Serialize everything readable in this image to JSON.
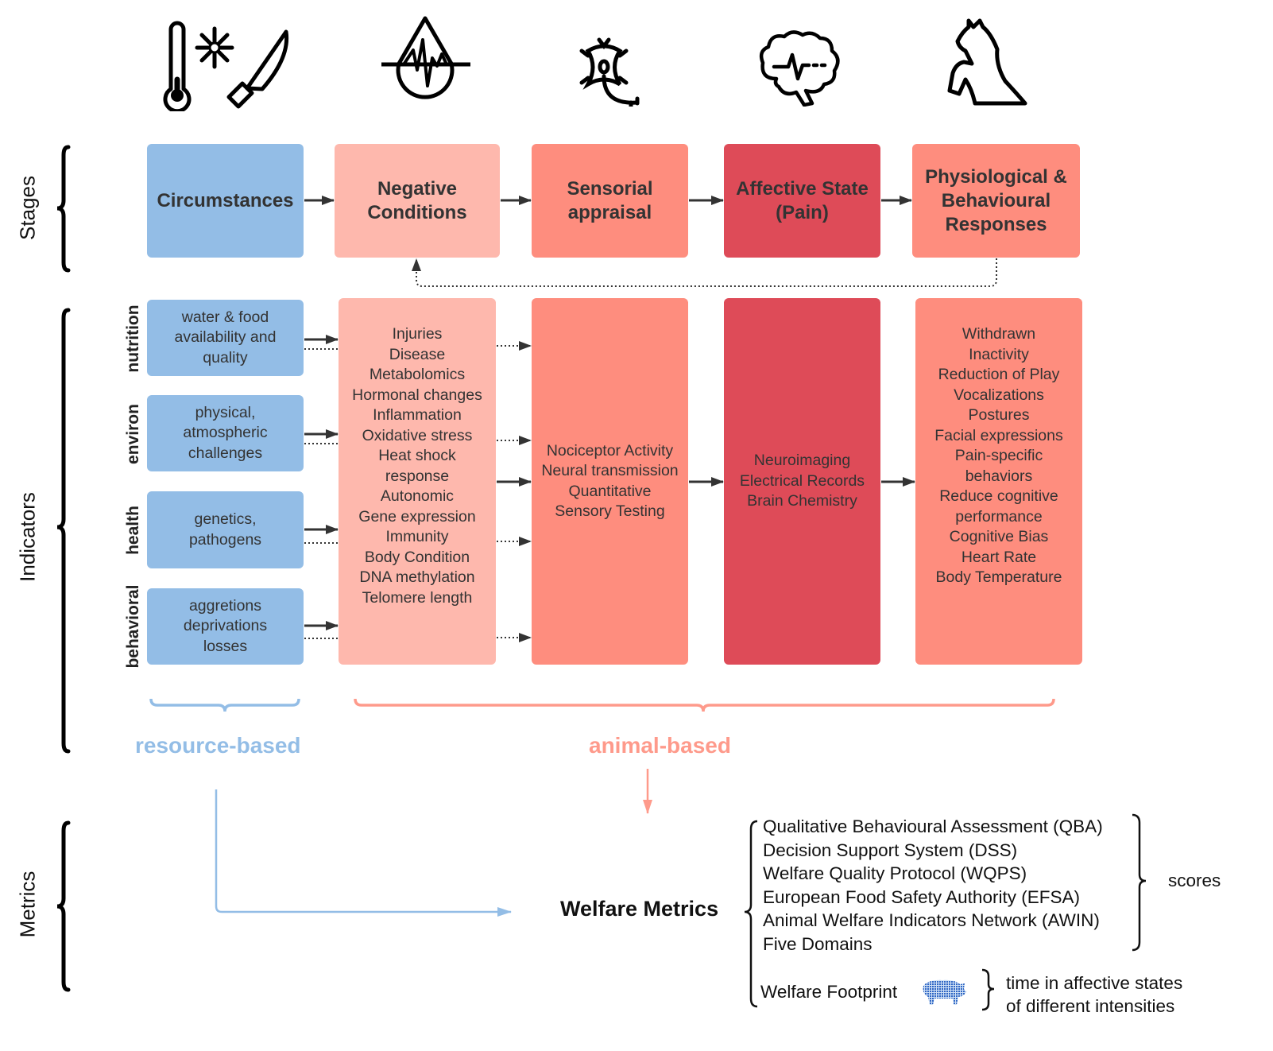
{
  "icons": [
    {
      "name": "thermometer-snowflake-knife-icon",
      "stage": "Circumstances"
    },
    {
      "name": "blood-drop-pulse-icon",
      "stage": "Negative Conditions"
    },
    {
      "name": "neuron-icon",
      "stage": "Sensorial appraisal"
    },
    {
      "name": "brain-pulse-icon",
      "stage": "Affective State"
    },
    {
      "name": "rearing-horse-icon",
      "stage": "Responses"
    }
  ],
  "sections": {
    "stages": "Stages",
    "indicators": "Indicators",
    "metrics": "Metrics"
  },
  "stages": [
    {
      "label": "Circumstances",
      "color": "#93bde6"
    },
    {
      "label": "Negative\nConditions",
      "color": "#feb8ad"
    },
    {
      "label": "Sensorial\nappraisal",
      "color": "#fe8d7e"
    },
    {
      "label": "Affective State\n(Pain)",
      "color": "#de4b58"
    },
    {
      "label": "Physiological &\nBehavioural\nResponses",
      "color": "#fe8d7e"
    }
  ],
  "categories": [
    {
      "label": "nutrition",
      "text": "water & food\navailability and\nquality"
    },
    {
      "label": "environ",
      "text": "physical,\natmospheric\nchallenges"
    },
    {
      "label": "health",
      "text": "genetics,\npathogens"
    },
    {
      "label": "behavioral",
      "text": "aggretions\ndeprivations\nlosses"
    }
  ],
  "indicator_columns": {
    "negative_conditions": "Injuries\nDisease\nMetabolomics\nHormonal changes\nInflammation\nOxidative stress\nHeat shock\nresponse\nAutonomic\nGene expression\nImmunity\nBody Condition\nDNA methylation\nTelomere length",
    "sensorial": "Nociceptor Activity\nNeural transmission\nQuantitative\nSensory Testing",
    "affective": "Neuroimaging\nElectrical Records\nBrain Chemistry",
    "responses": "Withdrawn\nInactivity\nReduction of Play\nVocalizations\nPostures\nFacial expressions\nPain-specific\nbehaviors\nReduce cognitive\nperformance\nCognitive Bias\nHeart Rate\nBody Temperature"
  },
  "groupings": {
    "resource_based": {
      "label": "resource-based",
      "color": "#93bde6"
    },
    "animal_based": {
      "label": "animal-based",
      "color": "#fe9a8b"
    }
  },
  "metrics": {
    "title": "Welfare Metrics",
    "score_methods": [
      "Qualitative Behavioural Assessment (QBA)",
      "Decision Support System (DSS)",
      "Welfare Quality Protocol (WQPS)",
      "European Food Safety Authority  (EFSA)",
      "Animal Welfare Indicators Network (AWIN)",
      "Five Domains"
    ],
    "scores_label": "scores",
    "footprint_label": "Welfare Footprint",
    "footprint_icon": "pig-icon",
    "footprint_desc": "time in affective states\nof different intensities"
  }
}
